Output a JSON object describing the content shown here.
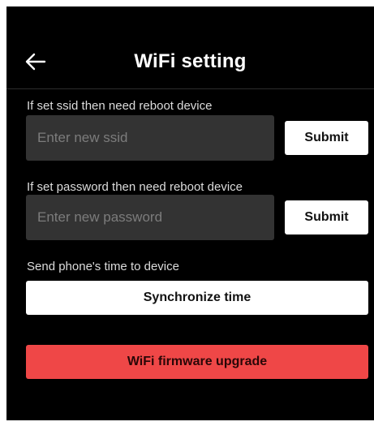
{
  "header": {
    "title": "WiFi setting",
    "back_icon": "arrow-left-icon"
  },
  "ssid": {
    "label": "If set ssid then need reboot device",
    "value": "",
    "placeholder": "Enter new ssid",
    "submit_label": "Submit"
  },
  "password": {
    "label": "If set password then need reboot device",
    "value": "",
    "placeholder": "Enter new password",
    "submit_label": "Submit"
  },
  "time_sync": {
    "label": "Send phone's time to device",
    "button_label": "Synchronize time"
  },
  "firmware": {
    "button_label": "WiFi firmware upgrade"
  },
  "colors": {
    "background": "#000000",
    "input_background": "#333333",
    "primary_button": "#ffffff",
    "danger_button": "#ef4747"
  }
}
